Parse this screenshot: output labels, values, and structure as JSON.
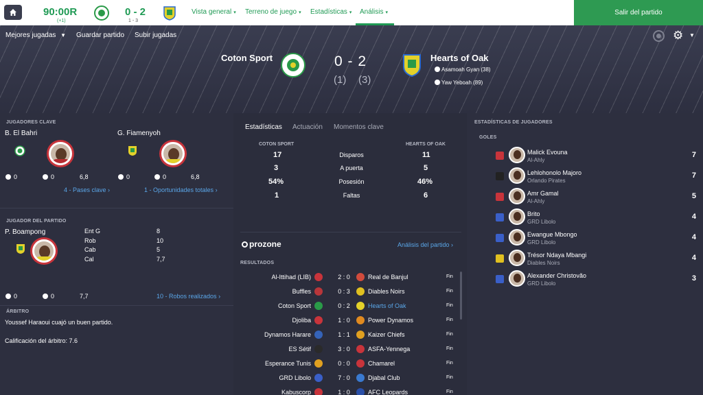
{
  "topbar": {
    "clock": "90:00R",
    "clock_sub": "(+1)",
    "score": "0 - 2",
    "score_sub": "1 - 3",
    "menus": [
      {
        "label": "Vista general"
      },
      {
        "label": "Terreno de juego"
      },
      {
        "label": "Estadísticas"
      },
      {
        "label": "Análisis"
      }
    ],
    "leave_label": "Salir del partido"
  },
  "toolbar": {
    "highlights": "Mejores jugadas",
    "save": "Guardar partido",
    "upload": "Subir jugadas"
  },
  "match": {
    "home": "Coton Sport",
    "away": "Hearts of Oak",
    "score": "0 - 2",
    "home_ht": "(1)",
    "away_ht": "(3)",
    "scorers": [
      "Asamoah Gyan (38)",
      "Yaw Yeboah (89)"
    ]
  },
  "key_players": {
    "title": "JUGADORES CLAVE",
    "p1": {
      "name": "B. El Bahri",
      "goals": "0",
      "assists": "0",
      "rating": "6,8",
      "link": "4 - Pases clave"
    },
    "p2": {
      "name": "G. Fiamenyoh",
      "goals": "0",
      "assists": "0",
      "rating": "6,8",
      "link": "1 - Oportunidades totales"
    }
  },
  "potm": {
    "title": "JUGADOR DEL PARTIDO",
    "name": "P. Boampong",
    "stats": [
      {
        "label": "Ent G",
        "value": "8"
      },
      {
        "label": "Rob",
        "value": "10"
      },
      {
        "label": "Cab",
        "value": "5"
      },
      {
        "label": "Cal",
        "value": "7,7"
      }
    ],
    "goals": "0",
    "assists": "0",
    "rating": "7,7",
    "link": "10 - Robos realizados"
  },
  "referee": {
    "title": "ÁRBITRO",
    "comment": "Youssef Haraoui cuajó un buen partido.",
    "rating": "Calificación del árbitro: 7.6"
  },
  "center": {
    "tabs": [
      "Estadísticas",
      "Actuación",
      "Momentos clave"
    ],
    "home_head": "COTON SPORT",
    "away_head": "HEARTS OF OAK",
    "stats": [
      {
        "label": "Disparos",
        "home": "17",
        "away": "11"
      },
      {
        "label": "A puerta",
        "home": "3",
        "away": "5"
      },
      {
        "label": "Posesión",
        "home": "54%",
        "away": "46%"
      },
      {
        "label": "Faltas",
        "home": "1",
        "away": "6"
      }
    ],
    "prozone": "prozone",
    "analysis_link": "Análisis del partido",
    "results_title": "RESULTADOS",
    "results": [
      {
        "home": "Al-Ittihad (LIB)",
        "score": "2 : 0",
        "away": "Real de Banjul",
        "status": "Fin",
        "c1": "#c8343b",
        "c2": "#d14b3c"
      },
      {
        "home": "Buffles",
        "score": "0 : 3",
        "away": "Diables Noirs",
        "status": "Fin",
        "c1": "#b8363a",
        "c2": "#e0c020"
      },
      {
        "home": "Coton Sport",
        "score": "0 : 2",
        "away": "Hearts of Oak",
        "status": "Fin",
        "c1": "#2a9a48",
        "c2": "#e3d12a",
        "highlight": true
      },
      {
        "home": "Djoliba",
        "score": "1 : 0",
        "away": "Power Dynamos",
        "status": "Fin",
        "c1": "#c8343b",
        "c2": "#e08a20"
      },
      {
        "home": "Dynamos Harare",
        "score": "1 : 1",
        "away": "Kaizer Chiefs",
        "status": "Fin",
        "c1": "#3563b8",
        "c2": "#e0a020"
      },
      {
        "home": "ES Sétif",
        "score": "3 : 0",
        "away": "ASFA-Yennega",
        "status": "Fin",
        "c1": "#2a2a2a",
        "c2": "#c8343b"
      },
      {
        "home": "Esperance Tunis",
        "score": "0 : 0",
        "away": "Chamarel",
        "status": "Fin",
        "c1": "#e0a020",
        "c2": "#c8343b"
      },
      {
        "home": "GRD Libolo",
        "score": "7 : 0",
        "away": "Djabal Club",
        "status": "Fin",
        "c1": "#3a5fc8",
        "c2": "#3a7ad0"
      },
      {
        "home": "Kabuscorp",
        "score": "1 : 0",
        "away": "AFC Leopards",
        "status": "Fin",
        "c1": "#c8343b",
        "c2": "#2a4fa8"
      }
    ]
  },
  "player_stats": {
    "title": "ESTADÍSTICAS DE JUGADORES",
    "subtitle": "GOLES",
    "rows": [
      {
        "name": "Malick Evouna",
        "club": "Al-Ahly",
        "goals": "7",
        "c": "#c8343b"
      },
      {
        "name": "Lehlohonolo Majoro",
        "club": "Orlando Pirates",
        "goals": "7",
        "c": "#222"
      },
      {
        "name": "Amr Gamal",
        "club": "Al-Ahly",
        "goals": "5",
        "c": "#c8343b"
      },
      {
        "name": "Brito",
        "club": "GRD Libolo",
        "goals": "4",
        "c": "#3a5fc8"
      },
      {
        "name": "Ewangue Mbongo",
        "club": "GRD Libolo",
        "goals": "4",
        "c": "#3a5fc8"
      },
      {
        "name": "Trésor Ndaya Mbangi",
        "club": "Diables Noirs",
        "goals": "4",
        "c": "#e0c020"
      },
      {
        "name": "Alexander Christovão",
        "club": "GRD Libolo",
        "goals": "3",
        "c": "#3a5fc8"
      }
    ]
  },
  "colors": {
    "accent": "#1f9a54",
    "link": "#5aa6e8",
    "leave_button": "#2e9a52"
  },
  "icons": [
    "home-icon",
    "record-icon",
    "gear-icon",
    "ball-icon",
    "chevron-down-icon"
  ]
}
